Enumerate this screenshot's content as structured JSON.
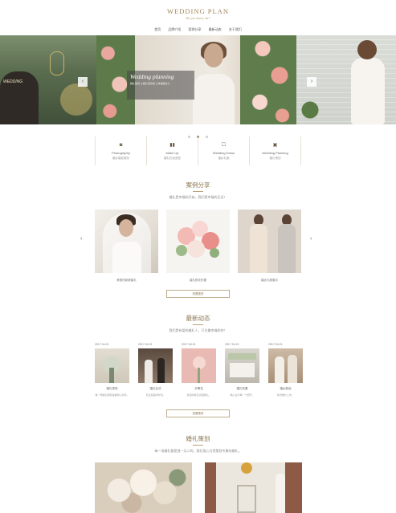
{
  "header": {
    "logo_main": "WEDDING PLAN",
    "logo_sub": "Do you marry me?",
    "nav": [
      "首页",
      "品牌介绍",
      "案例分享",
      "最新动态",
      "关于我们"
    ]
  },
  "banner": {
    "left_text": "WEDDING",
    "caption_title": "Wedding planning",
    "caption_sub": "婚礼策划 让婚礼更完美 让幸福更长久",
    "prev_label": "‹",
    "next_label": "›",
    "dots": 3,
    "active_dot": 2
  },
  "services": [
    {
      "icon": "camera-icon",
      "glyph": "◙",
      "en": "Photography",
      "cn": "婚纱摄影服务"
    },
    {
      "icon": "chart-icon",
      "glyph": "▮▮",
      "en": "Make Up",
      "cn": "婚礼化妆造型"
    },
    {
      "icon": "dress-icon",
      "glyph": "☐",
      "en": "Wedding Dress",
      "cn": "婚纱礼服"
    },
    {
      "icon": "plan-icon",
      "glyph": "▣",
      "en": "Wedding Planning",
      "cn": "婚礼策划"
    }
  ],
  "cases_section": {
    "title": "案例分享",
    "desc": "婚礼是幸福的开始，我们是幸福的见证！",
    "items": [
      {
        "caption": "美丽的新娘婚礼"
      },
      {
        "caption": "婚礼鲜花布置"
      },
      {
        "caption": "婚纱礼服展示"
      }
    ],
    "more": "查看更多"
  },
  "news_section": {
    "title": "最新动态",
    "desc": "我们是有爱的婚礼人，只为最幸福的你！",
    "items": [
      {
        "date": "2017.04.21",
        "title": "婚礼现场",
        "desc": "每一场婚礼都值得被用心对待。"
      },
      {
        "date": "2017.04.21",
        "title": "婚礼仪式",
        "desc": "见证最美的时刻。"
      },
      {
        "date": "2017.04.21",
        "title": "手捧花",
        "desc": "浪漫的鲜花点缀婚礼。"
      },
      {
        "date": "2017.04.21",
        "title": "婚礼布置",
        "desc": "精心设计每一个细节。"
      },
      {
        "date": "2017.04.21",
        "title": "婚纱新品",
        "desc": "新款婚纱上市。"
      }
    ],
    "more": "查看更多"
  },
  "planning_section": {
    "title": "婚礼策划",
    "desc": "每一场婚礼都是独一无二的，我们用心为您策划专属的婚礼。"
  },
  "colors": {
    "accent": "#8a7451",
    "line": "#b9a37a"
  }
}
